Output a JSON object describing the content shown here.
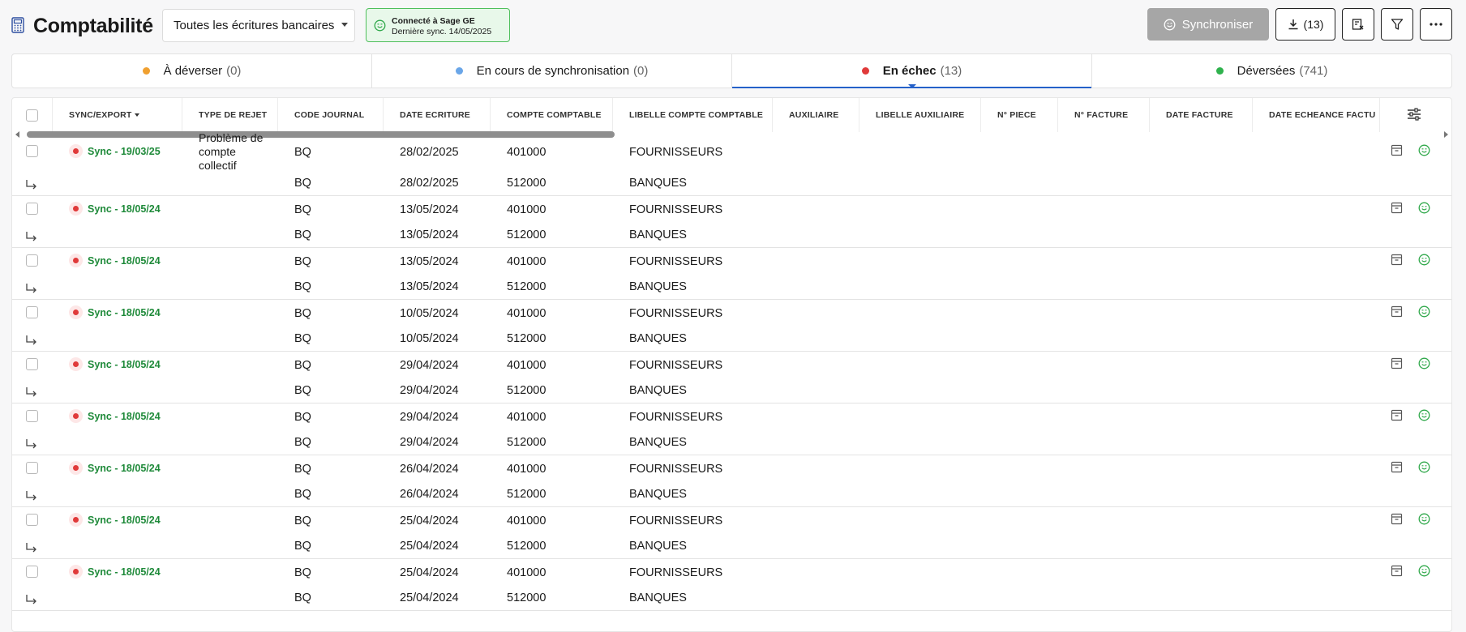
{
  "header": {
    "title": "Comptabilité",
    "filter_select": "Toutes les écritures bancaires",
    "sage_status": {
      "line1": "Connecté à Sage GE",
      "line2": "Dernière sync. 14/05/2025"
    },
    "sync_button": "Synchroniser",
    "export_button": "(13)",
    "icons": [
      "calculator-icon",
      "download-icon",
      "document-settings-icon",
      "filter-icon",
      "more-icon"
    ]
  },
  "tabs": [
    {
      "label": "À déverser",
      "count": "(0)",
      "color": "#f0a030"
    },
    {
      "label": "En cours de synchronisation",
      "count": "(0)",
      "color": "#6aa6e8"
    },
    {
      "label": "En échec",
      "count": "(13)",
      "color": "#e03a3a",
      "active": true
    },
    {
      "label": "Déversées",
      "count": "(741)",
      "color": "#2fb24d"
    }
  ],
  "columns": [
    "SYNC/EXPORT",
    "TYPE DE REJET",
    "CODE JOURNAL",
    "DATE ECRITURE",
    "COMPTE COMPTABLE",
    "LIBELLE COMPTE COMPTABLE",
    "AUXILIAIRE",
    "LIBELLE AUXILIAIRE",
    "N° PIECE",
    "N° FACTURE",
    "DATE FACTURE",
    "DATE ECHEANCE FACTU"
  ],
  "rows": [
    {
      "status": "Sync - 19/03/25",
      "rejet": "Problème de compte collectif",
      "journal": "BQ",
      "date": "28/02/2025",
      "compte1": "401000",
      "libelle1": "FOURNISSEURS",
      "compte2": "512000",
      "libelle2": "BANQUES"
    },
    {
      "status": "Sync - 18/05/24",
      "rejet": "",
      "journal": "BQ",
      "date": "13/05/2024",
      "compte1": "401000",
      "libelle1": "FOURNISSEURS",
      "compte2": "512000",
      "libelle2": "BANQUES"
    },
    {
      "status": "Sync - 18/05/24",
      "rejet": "",
      "journal": "BQ",
      "date": "13/05/2024",
      "compte1": "401000",
      "libelle1": "FOURNISSEURS",
      "compte2": "512000",
      "libelle2": "BANQUES"
    },
    {
      "status": "Sync - 18/05/24",
      "rejet": "",
      "journal": "BQ",
      "date": "10/05/2024",
      "compte1": "401000",
      "libelle1": "FOURNISSEURS",
      "compte2": "512000",
      "libelle2": "BANQUES"
    },
    {
      "status": "Sync - 18/05/24",
      "rejet": "",
      "journal": "BQ",
      "date": "29/04/2024",
      "compte1": "401000",
      "libelle1": "FOURNISSEURS",
      "compte2": "512000",
      "libelle2": "BANQUES"
    },
    {
      "status": "Sync - 18/05/24",
      "rejet": "",
      "journal": "BQ",
      "date": "29/04/2024",
      "compte1": "401000",
      "libelle1": "FOURNISSEURS",
      "compte2": "512000",
      "libelle2": "BANQUES"
    },
    {
      "status": "Sync - 18/05/24",
      "rejet": "",
      "journal": "BQ",
      "date": "26/04/2024",
      "compte1": "401000",
      "libelle1": "FOURNISSEURS",
      "compte2": "512000",
      "libelle2": "BANQUES"
    },
    {
      "status": "Sync - 18/05/24",
      "rejet": "",
      "journal": "BQ",
      "date": "25/04/2024",
      "compte1": "401000",
      "libelle1": "FOURNISSEURS",
      "compte2": "512000",
      "libelle2": "BANQUES"
    },
    {
      "status": "Sync - 18/05/24",
      "rejet": "",
      "journal": "BQ",
      "date": "25/04/2024",
      "compte1": "401000",
      "libelle1": "FOURNISSEURS",
      "compte2": "512000",
      "libelle2": "BANQUES"
    }
  ]
}
